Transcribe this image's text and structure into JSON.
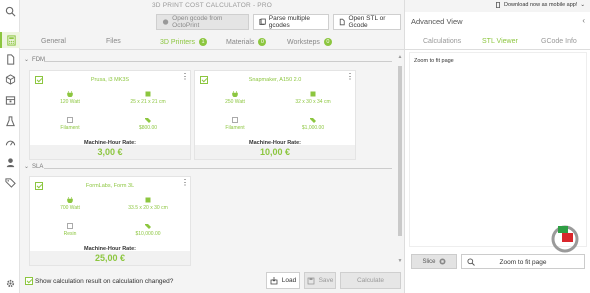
{
  "app": {
    "title": "3D PRINT COST CALCULATOR - PRO"
  },
  "toolbar": {
    "octoprint_label": "Open gcode from OctoPrint",
    "parse_label": "Parse multiple gcodes",
    "open_label": "Open STL or Gcode"
  },
  "tabs": [
    {
      "label": "General",
      "active": false
    },
    {
      "label": "Files",
      "active": false
    },
    {
      "label": "3D Printers",
      "badge": "1",
      "active": true
    },
    {
      "label": "Materials",
      "badge": "0",
      "active": false
    },
    {
      "label": "Worksteps",
      "badge": "0",
      "active": false
    }
  ],
  "groups": [
    {
      "name": "FDM",
      "printers": [
        {
          "name": "Prusa, i3 MK3S",
          "power": "120 Watt",
          "dims": "25 x 21 x 21 cm",
          "material": "Filament",
          "price": "$800.00",
          "rate_label": "Machine-Hour Rate:",
          "rate": "3,00 €"
        },
        {
          "name": "Snapmaker, A150 2.0",
          "power": "250 Watt",
          "dims": "32 x 30 x 34 cm",
          "material": "Filament",
          "price": "$1,000.00",
          "rate_label": "Machine-Hour Rate:",
          "rate": "10,00 €"
        }
      ]
    },
    {
      "name": "SLA",
      "printers": [
        {
          "name": "FormLabs, Form 3L",
          "power": "700 Watt",
          "dims": "33.5 x 20 x 30 cm",
          "material": "Resin",
          "price": "$10,000.00",
          "rate_label": "Machine-Hour Rate:",
          "rate": "25,00 €"
        }
      ]
    }
  ],
  "footer": {
    "checkbox_label": "Show calculation result on calculation changed?",
    "checkbox_checked": true,
    "load_label": "Load",
    "save_label": "Save",
    "calculate_label": "Calculate"
  },
  "right_pane": {
    "download_text": "Download now as mobile app!",
    "title": "Advanced View",
    "tabs": [
      {
        "label": "Calculations",
        "active": false
      },
      {
        "label": "STL Viewer",
        "active": true
      },
      {
        "label": "GCode Info",
        "active": false
      }
    ],
    "zoom_hint": "Zoom to fit page",
    "slice_label": "Slice",
    "zoom_button_label": "Zoom to fit page"
  },
  "colors": {
    "accent": "#8cc63f",
    "widget_red": "#d9262c",
    "widget_green": "#2e9e44"
  },
  "icons": {
    "rail": [
      "calculator-icon",
      "file-icon",
      "cube-icon",
      "printer-icon",
      "flask-icon",
      "gear-icon",
      "wrench-icon",
      "cloud-icon",
      "share-icon",
      "settings-icon"
    ]
  }
}
